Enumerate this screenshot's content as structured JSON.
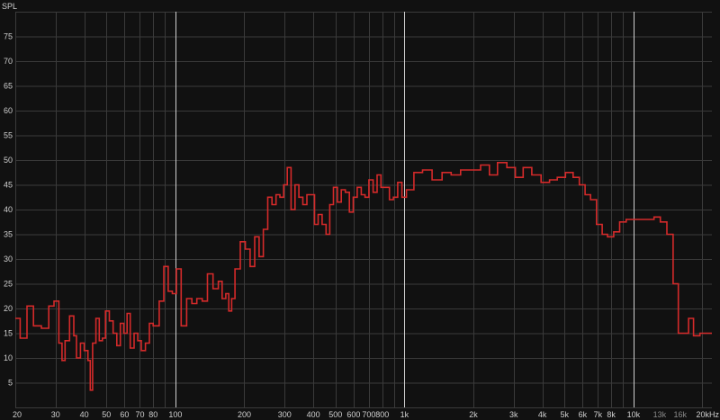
{
  "chart_data": {
    "type": "line",
    "ylabel": "SPL",
    "xunit": "kHz",
    "xscale": "log",
    "xlim": [
      20,
      22000
    ],
    "ylim": [
      0,
      80
    ],
    "grid": true,
    "background_color": "#111111",
    "grid_color": "#3a3a3a",
    "major_grid_color": "#cfcfcf",
    "line_color": "#d42a2a",
    "y_ticks": [
      5,
      10,
      15,
      20,
      25,
      30,
      35,
      40,
      45,
      50,
      55,
      60,
      65,
      70,
      75
    ],
    "x_ticks": [
      {
        "value": 20,
        "label": "20"
      },
      {
        "value": 30,
        "label": "30"
      },
      {
        "value": 40,
        "label": "40"
      },
      {
        "value": 50,
        "label": "50"
      },
      {
        "value": 60,
        "label": "60"
      },
      {
        "value": 70,
        "label": "70"
      },
      {
        "value": 80,
        "label": "80"
      },
      {
        "value": 100,
        "label": "100"
      },
      {
        "value": 200,
        "label": "200"
      },
      {
        "value": 300,
        "label": "300"
      },
      {
        "value": 400,
        "label": "400"
      },
      {
        "value": 500,
        "label": "500"
      },
      {
        "value": 600,
        "label": "600"
      },
      {
        "value": 700,
        "label": "700"
      },
      {
        "value": 800,
        "label": "800"
      },
      {
        "value": 1000,
        "label": "1k"
      },
      {
        "value": 2000,
        "label": "2k"
      },
      {
        "value": 3000,
        "label": "3k"
      },
      {
        "value": 4000,
        "label": "4k"
      },
      {
        "value": 5000,
        "label": "5k"
      },
      {
        "value": 6000,
        "label": "6k"
      },
      {
        "value": 7000,
        "label": "7k"
      },
      {
        "value": 8000,
        "label": "8k"
      },
      {
        "value": 10000,
        "label": "10k"
      },
      {
        "value": 13000,
        "label": "13k",
        "dim": true
      },
      {
        "value": 16000,
        "label": "16k",
        "dim": true
      },
      {
        "value": 20000,
        "label": "20kHz"
      }
    ],
    "major_x": [
      100,
      1000,
      10000
    ],
    "series": [
      {
        "points": [
          [
            20,
            18
          ],
          [
            21,
            14
          ],
          [
            22.5,
            20.5
          ],
          [
            24,
            16.5
          ],
          [
            26,
            16
          ],
          [
            28,
            20.5
          ],
          [
            29.5,
            21.5
          ],
          [
            31,
            13
          ],
          [
            32,
            9.5
          ],
          [
            33,
            13.5
          ],
          [
            34.5,
            18.5
          ],
          [
            36,
            14.5
          ],
          [
            37,
            10
          ],
          [
            38.5,
            13
          ],
          [
            40,
            11.5
          ],
          [
            41.5,
            9.5
          ],
          [
            42.5,
            3.5
          ],
          [
            43.5,
            13
          ],
          [
            45,
            18
          ],
          [
            46.5,
            13.5
          ],
          [
            48,
            14
          ],
          [
            49.5,
            19.5
          ],
          [
            51.5,
            17.5
          ],
          [
            53.5,
            15
          ],
          [
            55.5,
            12.5
          ],
          [
            57.5,
            17
          ],
          [
            59.5,
            15
          ],
          [
            61.5,
            19
          ],
          [
            63.5,
            12
          ],
          [
            66,
            15
          ],
          [
            68.5,
            13.5
          ],
          [
            71,
            11.5
          ],
          [
            74,
            13
          ],
          [
            77,
            17
          ],
          [
            80,
            16.5
          ],
          [
            85,
            21.5
          ],
          [
            89,
            28.5
          ],
          [
            93,
            23.5
          ],
          [
            97,
            23
          ],
          [
            101,
            28
          ],
          [
            106,
            16.5
          ],
          [
            112,
            22
          ],
          [
            118,
            21
          ],
          [
            124,
            22
          ],
          [
            131,
            21.5
          ],
          [
            138,
            27
          ],
          [
            146,
            24
          ],
          [
            154,
            25.5
          ],
          [
            160,
            22
          ],
          [
            166,
            23
          ],
          [
            171,
            19.5
          ],
          [
            176,
            22
          ],
          [
            182,
            28
          ],
          [
            192,
            33.5
          ],
          [
            202,
            32
          ],
          [
            212,
            28.5
          ],
          [
            222,
            34.5
          ],
          [
            232,
            30.5
          ],
          [
            242,
            36
          ],
          [
            253,
            42.5
          ],
          [
            264,
            41
          ],
          [
            275,
            43
          ],
          [
            286,
            42.5
          ],
          [
            297,
            45
          ],
          [
            308,
            48.5
          ],
          [
            320,
            40
          ],
          [
            333,
            45
          ],
          [
            346,
            42.5
          ],
          [
            360,
            41
          ],
          [
            375,
            43
          ],
          [
            390,
            43
          ],
          [
            405,
            37
          ],
          [
            420,
            39
          ],
          [
            437,
            37
          ],
          [
            455,
            35
          ],
          [
            472,
            41
          ],
          [
            490,
            44.5
          ],
          [
            510,
            41.5
          ],
          [
            530,
            44
          ],
          [
            552,
            43.5
          ],
          [
            575,
            39.5
          ],
          [
            598,
            42.5
          ],
          [
            622,
            44.5
          ],
          [
            648,
            43
          ],
          [
            673,
            42.5
          ],
          [
            700,
            46
          ],
          [
            730,
            43.5
          ],
          [
            760,
            47
          ],
          [
            790,
            44.5
          ],
          [
            825,
            44.5
          ],
          [
            860,
            42
          ],
          [
            895,
            42.5
          ],
          [
            935,
            45.5
          ],
          [
            975,
            42.5
          ],
          [
            1020,
            44
          ],
          [
            1100,
            47.5
          ],
          [
            1200,
            48
          ],
          [
            1320,
            46
          ],
          [
            1460,
            47.5
          ],
          [
            1600,
            47
          ],
          [
            1760,
            48
          ],
          [
            1950,
            48
          ],
          [
            2150,
            49
          ],
          [
            2350,
            47
          ],
          [
            2550,
            49.5
          ],
          [
            2800,
            48.5
          ],
          [
            3050,
            46.5
          ],
          [
            3300,
            48.5
          ],
          [
            3600,
            47
          ],
          [
            3950,
            45.5
          ],
          [
            4300,
            46
          ],
          [
            4650,
            46.5
          ],
          [
            5050,
            47.5
          ],
          [
            5450,
            46.5
          ],
          [
            5800,
            45
          ],
          [
            6150,
            43
          ],
          [
            6500,
            42
          ],
          [
            6900,
            37
          ],
          [
            7300,
            35
          ],
          [
            7700,
            34.5
          ],
          [
            8200,
            35.5
          ],
          [
            8700,
            37.5
          ],
          [
            9300,
            38
          ],
          [
            10000,
            38
          ],
          [
            10700,
            38
          ],
          [
            11500,
            38
          ],
          [
            12300,
            38.5
          ],
          [
            13100,
            37.5
          ],
          [
            14000,
            35
          ],
          [
            14900,
            25
          ],
          [
            15700,
            15
          ],
          [
            16600,
            15
          ],
          [
            17400,
            18
          ],
          [
            18300,
            14.5
          ],
          [
            19500,
            15
          ]
        ]
      }
    ]
  }
}
